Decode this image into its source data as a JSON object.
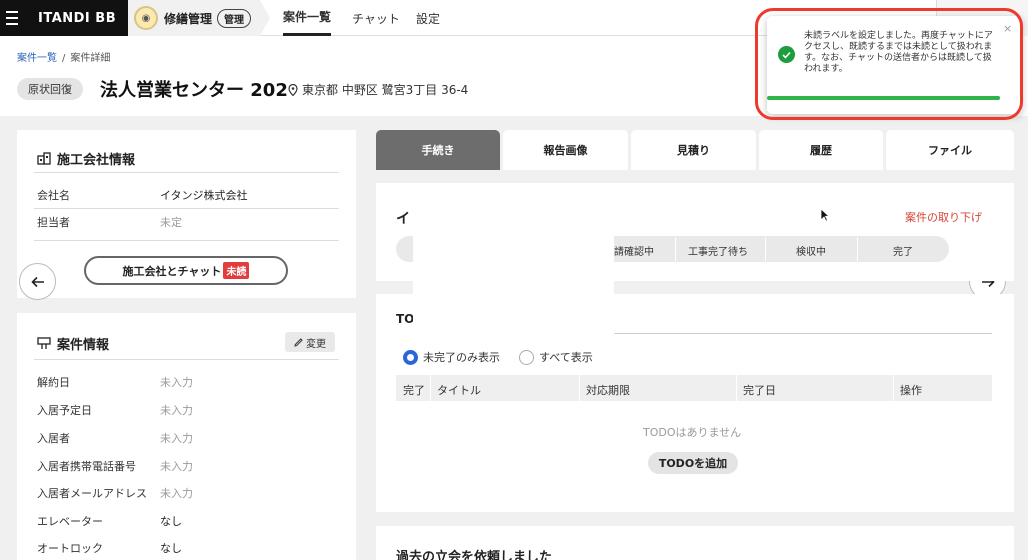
{
  "topbar": {
    "brand": "ITANDI BB",
    "app_name": "修繕管理",
    "app_badge": "管理",
    "nav": [
      "案件一覧",
      "チャット",
      "設定"
    ]
  },
  "header": {
    "breadcrumb": [
      "案件一覧",
      "案件詳細"
    ],
    "status": "原状回復",
    "title": "法人営業センター 202",
    "address": "東京都 中野区 鷺宮3丁目 36-4"
  },
  "contractor": {
    "title": "施工会社情報",
    "rows": [
      {
        "label": "会社名",
        "value": "イタンジ株式会社"
      },
      {
        "label": "担当者",
        "value": "未定"
      }
    ],
    "chat_button": "施工会社とチャット",
    "unread": "未読"
  },
  "case_info": {
    "title": "案件情報",
    "change_button": "変更",
    "rows": [
      {
        "label": "解約日",
        "value": "未入力"
      },
      {
        "label": "入居予定日",
        "value": "未入力"
      },
      {
        "label": "入居者",
        "value": "未入力"
      },
      {
        "label": "入居者携帯電話番号",
        "value": "未入力"
      },
      {
        "label": "入居者メールアドレス",
        "value": "未入力"
      },
      {
        "label": "エレベーター",
        "value": "なし"
      },
      {
        "label": "オートロック",
        "value": "なし"
      }
    ]
  },
  "tabs": [
    "手続き",
    "報告画像",
    "見積り",
    "履歴",
    "ファイル"
  ],
  "procedure": {
    "heading_partial": "イ",
    "withdraw": "案件の取り下げ",
    "steps": [
      "請確認中",
      "工事完了待ち",
      "検収中",
      "完了"
    ]
  },
  "todo": {
    "heading_partial": "TO",
    "radio_incomplete": "未完了のみ表示",
    "radio_all": "すべて表示",
    "columns": [
      "完了",
      "タイトル",
      "対応期限",
      "完了日",
      "操作"
    ],
    "empty": "TODOはありません",
    "add_button": "TODOを追加"
  },
  "past_request": {
    "title": "過去の立会を依頼しました"
  },
  "toast": {
    "message": "未読ラベルを設定しました。再度チャットにアクセスし、既読するまでは未読として扱われます。なお、チャットの送信者からは既読して扱われます。",
    "close": "×"
  },
  "colors": {
    "accent_green": "#2fb34a",
    "highlight_red": "#ee3a2c",
    "link_blue": "#2b66b8",
    "withdraw_red": "#d6453a"
  }
}
